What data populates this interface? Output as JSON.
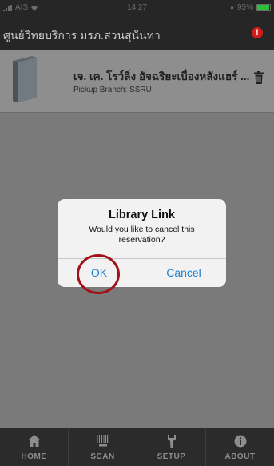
{
  "status_bar": {
    "carrier": "AIS",
    "time": "14:27",
    "battery_percent": "95%",
    "battery_level": 0.95
  },
  "navbar": {
    "title": "ศูนย์วิทยบริการ มรภ.สวนสุนันทา",
    "alert_icon": "exclamation-icon"
  },
  "reservation": {
    "title": "เจ. เค. โรว์ลิ่ง อัจฉริยะเบื่องหลังแฮร์ ...",
    "pickup": "Pickup Branch: SSRU"
  },
  "dialog": {
    "title": "Library Link",
    "message": "Would you like to cancel this reservation?",
    "ok_label": "OK",
    "cancel_label": "Cancel"
  },
  "tabs": [
    {
      "label": "HOME",
      "icon": "home-icon"
    },
    {
      "label": "SCAN",
      "icon": "barcode-icon"
    },
    {
      "label": "SETUP",
      "icon": "wrench-icon"
    },
    {
      "label": "ABOUT",
      "icon": "info-icon"
    }
  ],
  "colors": {
    "accent": "#1a7fd4",
    "highlight": "#a01218",
    "bar_bg": "#262626",
    "battery": "#2bbf3a"
  }
}
